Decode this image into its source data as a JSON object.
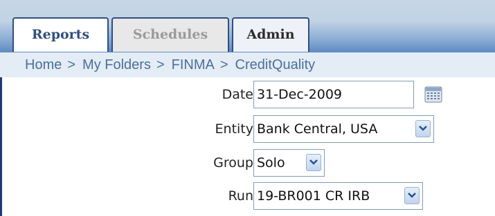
{
  "tabs": [
    {
      "label": "Reports",
      "active": true
    },
    {
      "label": "Schedules",
      "active": false
    },
    {
      "label": "Admin",
      "active": false
    }
  ],
  "breadcrumb": {
    "items": [
      "Home",
      "My Folders",
      "FINMA",
      "CreditQuality"
    ],
    "separator": ">"
  },
  "form": {
    "date": {
      "label": "Date",
      "value": "31-Dec-2009",
      "icon": "calendar-icon"
    },
    "entity": {
      "label": "Entity",
      "value": "Bank Central, USA",
      "icon": "chevron-down-icon"
    },
    "group": {
      "label": "Group",
      "value": "Solo",
      "icon": "chevron-down-icon"
    },
    "run": {
      "label": "Run",
      "value": "19-BR001 CR IRB",
      "icon": "chevron-down-icon"
    }
  },
  "colors": {
    "header_top": "#c7d6e6",
    "header_bottom": "#5f8cc4",
    "tab_text": "#2f4f7f",
    "breadcrumb_bg": "#e4ecf5",
    "breadcrumb_text": "#4a6f9d",
    "field_border": "#7f9db9"
  }
}
